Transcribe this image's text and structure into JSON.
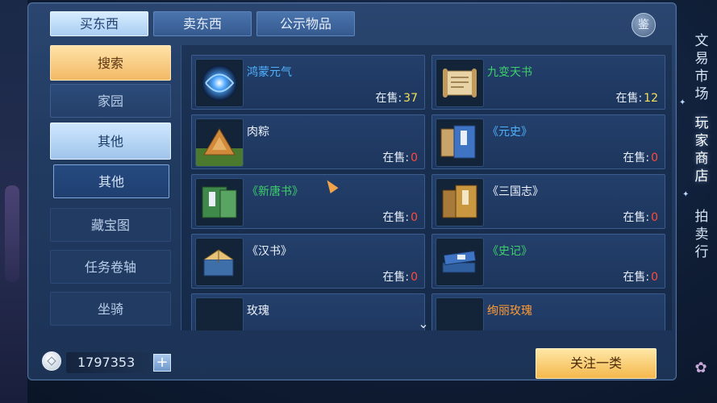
{
  "top_strip": "",
  "tabs": [
    {
      "label": "买东西"
    },
    {
      "label": "卖东西"
    },
    {
      "label": "公示物品"
    }
  ],
  "appraise_label": "鉴",
  "menu": [
    {
      "label": "搜索"
    },
    {
      "label": "家园"
    },
    {
      "label": "其他"
    },
    {
      "label": "其他"
    },
    {
      "label": "藏宝图"
    },
    {
      "label": "任务卷轴"
    },
    {
      "label": "坐骑"
    }
  ],
  "items": [
    {
      "name": "鸿蒙元气",
      "sale_label": "在售:",
      "count": "37"
    },
    {
      "name": "九变天书",
      "sale_label": "在售:",
      "count": "12"
    },
    {
      "name": "肉粽",
      "sale_label": "在售:",
      "count": "0"
    },
    {
      "name": "《元史》",
      "sale_label": "在售:",
      "count": "0"
    },
    {
      "name": "《新唐书》",
      "sale_label": "在售:",
      "count": "0"
    },
    {
      "name": "《三国志》",
      "sale_label": "在售:",
      "count": "0"
    },
    {
      "name": "《汉书》",
      "sale_label": "在售:",
      "count": "0"
    },
    {
      "name": "《史记》",
      "sale_label": "在售:",
      "count": "0"
    },
    {
      "name": "玫瑰",
      "sale_label": "",
      "count": ""
    },
    {
      "name": "绚丽玫瑰",
      "sale_label": "",
      "count": ""
    }
  ],
  "bottom": {
    "money": "1797353",
    "plus": "+",
    "follow_label": "关注一类"
  },
  "right_nav": [
    {
      "label": "文易市场"
    },
    {
      "label": "玩家商店"
    },
    {
      "label": "拍卖行"
    }
  ],
  "colors": {
    "blue_name": "#4fb2ff",
    "green_name": "#3ed06b",
    "orange_name": "#ff9b34",
    "count_yellow": "#f6e15a",
    "count_red": "#ff4a3a"
  },
  "icons": [
    "coin-icon",
    "plus-icon",
    "chevron-down-icon",
    "appraise-icon"
  ]
}
